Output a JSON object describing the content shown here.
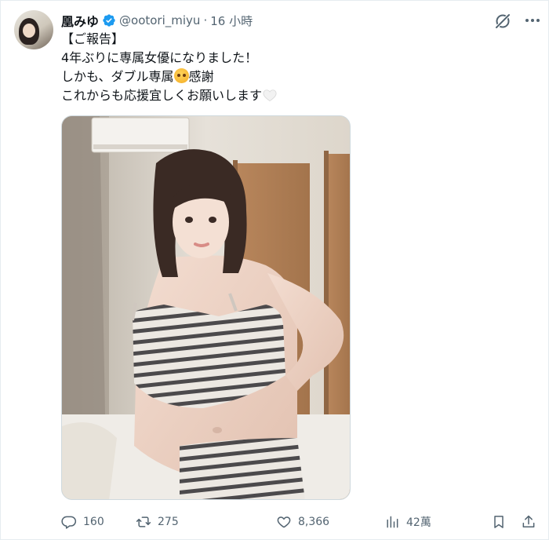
{
  "post": {
    "author": {
      "display_name": "凰みゆ",
      "handle": "@ootori_miyu",
      "separator": "·",
      "time": "16 小時",
      "verified": true,
      "verified_color": "#1d9bf0"
    },
    "text": {
      "line1": "【ご報告】",
      "line2": "4年ぶりに専属女優になりました！",
      "line3_before_emoji": "しかも、ダブル専属",
      "line3_after_emoji": "感謝",
      "line4": "これからも応援宜しくお願いします",
      "emoji_names": [
        "pleading-face-emoji",
        "white-heart-emoji"
      ]
    },
    "media": {
      "image_label": "post-photo"
    },
    "stats": {
      "replies": "160",
      "reposts": "275",
      "likes": "8,366",
      "views": "42萬"
    },
    "icons": [
      "verified-badge-icon",
      "grok-icon",
      "more-icon",
      "reply-icon",
      "repost-icon",
      "like-icon",
      "views-icon",
      "bookmark-icon",
      "share-icon"
    ],
    "colors": {
      "text_primary": "#0f1419",
      "text_secondary": "#536471",
      "border": "#cfd9de",
      "accent": "#1d9bf0"
    }
  }
}
